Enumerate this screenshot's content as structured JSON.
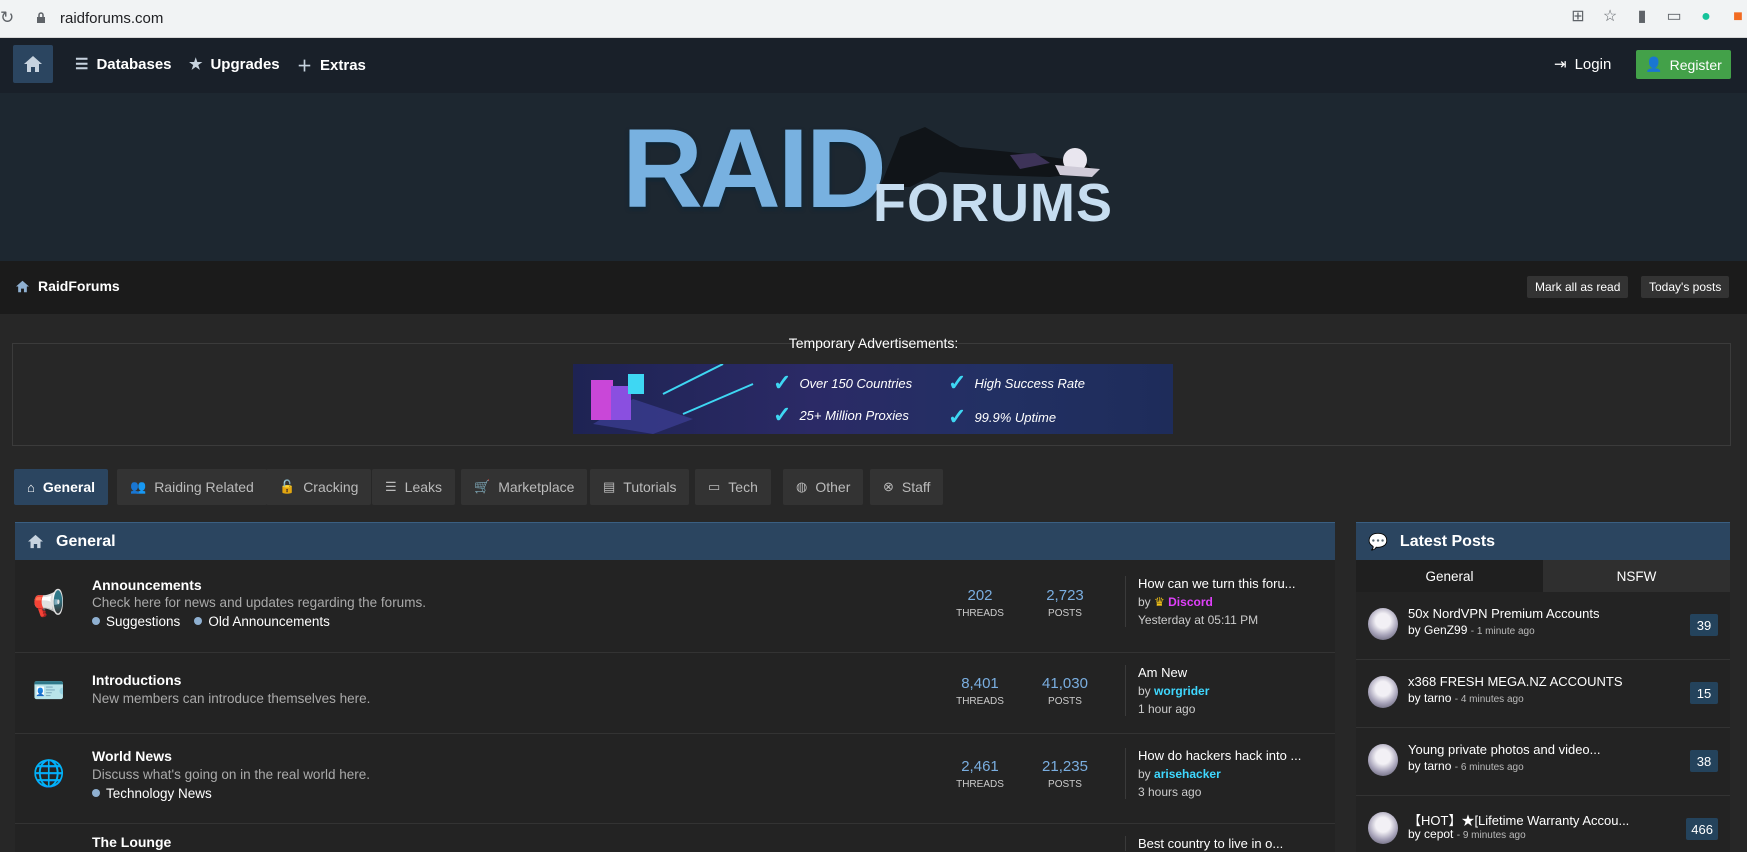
{
  "browser": {
    "url": "raidforums.com"
  },
  "nav": {
    "links": [
      {
        "label": "Databases",
        "icon": "database-icon"
      },
      {
        "label": "Upgrades",
        "icon": "star-icon"
      },
      {
        "label": "Extras",
        "icon": "plus-icon"
      }
    ],
    "login": "Login",
    "register": "Register"
  },
  "logo": {
    "word1": "RAID",
    "word2": "FORUMS"
  },
  "breadcrumb": {
    "label": "RaidForums",
    "mark_read": "Mark all as read",
    "todays_posts": "Today's posts"
  },
  "ads": {
    "title": "Temporary Advertisements:",
    "items": [
      "Over 150 Countries",
      "High Success Rate",
      "25+ Million Proxies",
      "99.9% Uptime"
    ]
  },
  "tabs": [
    {
      "label": "General",
      "icon": "home-icon",
      "active": true
    },
    {
      "label": "Raiding Related",
      "icon": "users-icon"
    },
    {
      "label": "Cracking",
      "icon": "unlock-icon"
    },
    {
      "label": "Leaks",
      "icon": "database-icon"
    },
    {
      "label": "Marketplace",
      "icon": "cart-icon"
    },
    {
      "label": "Tutorials",
      "icon": "book-icon"
    },
    {
      "label": "Tech",
      "icon": "laptop-icon"
    },
    {
      "label": "Other",
      "icon": "globe-icon"
    },
    {
      "label": "Staff",
      "icon": "lifebuoy-icon"
    }
  ],
  "forum": {
    "title": "General",
    "rows": [
      {
        "title": "Announcements",
        "desc": "Check here for news and updates regarding the forums.",
        "subs": [
          "Suggestions",
          "Old Announcements"
        ],
        "threads": "202",
        "posts": "2,723",
        "last_title": "How can we turn this foru...",
        "by": "by",
        "last_user": "Discord",
        "last_time": "Yesterday at 05:11 PM"
      },
      {
        "title": "Introductions",
        "desc": "New members can introduce themselves here.",
        "subs": [],
        "threads": "8,401",
        "posts": "41,030",
        "last_title": "Am New",
        "by": "by",
        "last_user": "worgrider",
        "last_time": "1 hour ago"
      },
      {
        "title": "World News",
        "desc": "Discuss what's going on in the real world here.",
        "subs": [
          "Technology News"
        ],
        "threads": "2,461",
        "posts": "21,235",
        "last_title": "How do hackers hack into ...",
        "by": "by",
        "last_user": "arisehacker",
        "last_time": "3 hours ago"
      },
      {
        "title": "The Lounge",
        "last_title": "Best country to live in o..."
      }
    ],
    "threads_label": "THREADS",
    "posts_label": "POSTS"
  },
  "latest": {
    "title": "Latest Posts",
    "tabs": [
      "General",
      "NSFW"
    ],
    "items": [
      {
        "title": "50x NordVPN Premium Accounts",
        "user": "GenZ99",
        "time": "- 1 minute ago",
        "count": "39"
      },
      {
        "title": "x368 FRESH MEGA.NZ ACCOUNTS",
        "user": "tarno",
        "time": "- 4 minutes ago",
        "count": "15"
      },
      {
        "title": "Young private photos and video...",
        "user": "tarno",
        "time": "- 6 minutes ago",
        "count": "38"
      },
      {
        "title": "【HOT】★[Lifetime Warranty Accou...",
        "user": "cepot",
        "time": "- 9 minutes ago",
        "count": "466"
      }
    ]
  },
  "colors": {
    "accent": "#2b4560",
    "register": "#43a149",
    "link_user": "#3fd8ff",
    "staff_user": "#e040fb"
  }
}
